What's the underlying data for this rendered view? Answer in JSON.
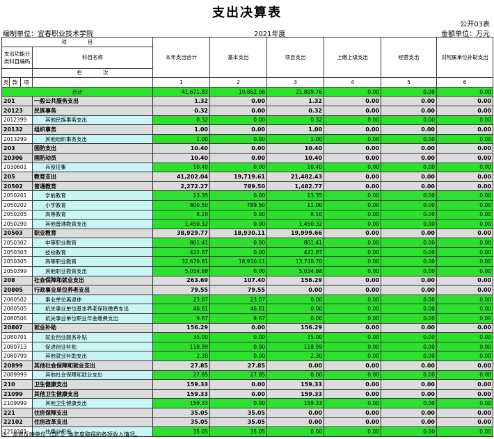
{
  "title": "支出决算表",
  "table_code": "公开03表",
  "unit_label": "编制单位：宜春职业技术学院",
  "year": "2021年度",
  "amount_unit": "金额单位：万元",
  "headers": {
    "xiangmu": "项　　　　目",
    "func_code": "支出功能分类科目编码",
    "subject_name": "科目名称",
    "lan_ci": "栏　　　　次",
    "lei": "类",
    "kuan": "款",
    "xiang": "项",
    "cols": [
      "本年支出合计",
      "基本支出",
      "项目支出",
      "上缴上级支出",
      "经营支出",
      "对附属单位补助支出"
    ],
    "col_nums": [
      "1",
      "2",
      "3",
      "4",
      "5",
      "6"
    ]
  },
  "total_label": "合计",
  "total_values": [
    "41,671.83",
    "19,862.06",
    "21,809.76",
    "0.00",
    "0.00",
    "0.00"
  ],
  "rows": [
    {
      "code": "201",
      "name": "一般公共服务支出",
      "v": [
        "1.32",
        "0.00",
        "1.32",
        "0.00",
        "0.00",
        "0.00"
      ],
      "bold": true
    },
    {
      "code": "20123",
      "name": "民族事务",
      "v": [
        "0.32",
        "0.00",
        "0.32",
        "0.00",
        "0.00",
        "0.00"
      ],
      "bold": true
    },
    {
      "code": "2012399",
      "name": "其他民族事务支出",
      "v": [
        "0.32",
        "0.00",
        "0.32",
        "0.00",
        "0.00",
        "0.00"
      ],
      "bold": false
    },
    {
      "code": "20132",
      "name": "组织事务",
      "v": [
        "1.00",
        "0.00",
        "1.00",
        "0.00",
        "0.00",
        "0.00"
      ],
      "bold": true
    },
    {
      "code": "2013299",
      "name": "其他组织事务支出",
      "v": [
        "1.00",
        "0.00",
        "1.00",
        "0.00",
        "0.00",
        "0.00"
      ],
      "bold": false
    },
    {
      "code": "203",
      "name": "国防支出",
      "v": [
        "10.40",
        "0.00",
        "10.40",
        "0.00",
        "0.00",
        "0.00"
      ],
      "bold": true
    },
    {
      "code": "20306",
      "name": "国防动员",
      "v": [
        "10.40",
        "0.00",
        "10.40",
        "0.00",
        "0.00",
        "0.00"
      ],
      "bold": true
    },
    {
      "code": "2030601",
      "name": "兵役征集",
      "v": [
        "10.40",
        "0.00",
        "10.40",
        "0.00",
        "0.00",
        "0.00"
      ],
      "bold": false
    },
    {
      "code": "205",
      "name": "教育支出",
      "v": [
        "41,202.04",
        "19,719.61",
        "21,482.43",
        "0.00",
        "0.00",
        "0.00"
      ],
      "bold": true
    },
    {
      "code": "20502",
      "name": "普通教育",
      "v": [
        "2,272.27",
        "789.50",
        "1,482.77",
        "0.00",
        "0.00",
        "0.00"
      ],
      "bold": true
    },
    {
      "code": "2050201",
      "name": "学前教育",
      "v": [
        "13.35",
        "0.00",
        "13.35",
        "0.00",
        "0.00",
        "0.00"
      ],
      "bold": false
    },
    {
      "code": "2050202",
      "name": "小学教育",
      "v": [
        "800.50",
        "789.50",
        "11.00",
        "0.00",
        "0.00",
        "0.00"
      ],
      "bold": false
    },
    {
      "code": "2050205",
      "name": "高等教育",
      "v": [
        "8.10",
        "0.00",
        "8.10",
        "0.00",
        "0.00",
        "0.00"
      ],
      "bold": false
    },
    {
      "code": "2050299",
      "name": "其他普通教育支出",
      "v": [
        "1,450.32",
        "0.00",
        "1,450.32",
        "0.00",
        "0.00",
        "0.00"
      ],
      "bold": false
    },
    {
      "code": "20503",
      "name": "职业教育",
      "v": [
        "38,929.77",
        "18,930.11",
        "19,999.66",
        "0.00",
        "0.00",
        "0.00"
      ],
      "bold": true
    },
    {
      "code": "2050302",
      "name": "中等职业教育",
      "v": [
        "801.41",
        "0.00",
        "801.41",
        "0.00",
        "0.00",
        "0.00"
      ],
      "bold": false
    },
    {
      "code": "2050303",
      "name": "技校教育",
      "v": [
        "422.87",
        "0.00",
        "422.87",
        "0.00",
        "0.00",
        "0.00"
      ],
      "bold": false
    },
    {
      "code": "2050305",
      "name": "高等职业教育",
      "v": [
        "32,670.81",
        "18,930.11",
        "13,740.70",
        "0.00",
        "0.00",
        "0.00"
      ],
      "bold": false
    },
    {
      "code": "2050399",
      "name": "其他职业教育支出",
      "v": [
        "5,034.68",
        "0.00",
        "5,034.68",
        "0.00",
        "0.00",
        "0.00"
      ],
      "bold": false
    },
    {
      "code": "208",
      "name": "社会保障和就业支出",
      "v": [
        "263.69",
        "107.40",
        "156.29",
        "0.00",
        "0.00",
        "0.00"
      ],
      "bold": true
    },
    {
      "code": "20805",
      "name": "行政事业单位养老支出",
      "v": [
        "79.55",
        "79.55",
        "0.00",
        "0.00",
        "0.00",
        "0.00"
      ],
      "bold": true
    },
    {
      "code": "2080502",
      "name": "事业单位离退休",
      "v": [
        "23.07",
        "23.07",
        "0.00",
        "0.00",
        "0.00",
        "0.00"
      ],
      "bold": false
    },
    {
      "code": "2080505",
      "name": "机关事业单位基本养老保险缴费支出",
      "v": [
        "46.81",
        "46.81",
        "0.00",
        "0.00",
        "0.00",
        "0.00"
      ],
      "bold": false
    },
    {
      "code": "2080506",
      "name": "机关事业单位职业年金缴费支出",
      "v": [
        "9.67",
        "9.67",
        "0.00",
        "0.00",
        "0.00",
        "0.00"
      ],
      "bold": false
    },
    {
      "code": "20807",
      "name": "就业补助",
      "v": [
        "156.29",
        "0.00",
        "156.29",
        "0.00",
        "0.00",
        "0.00"
      ],
      "bold": true
    },
    {
      "code": "2080701",
      "name": "就业创业服务补贴",
      "v": [
        "35.00",
        "0.00",
        "35.00",
        "0.00",
        "0.00",
        "0.00"
      ],
      "bold": false
    },
    {
      "code": "2080713",
      "name": "促进创业补贴",
      "v": [
        "118.99",
        "0.00",
        "118.99",
        "0.00",
        "0.00",
        "0.00"
      ],
      "bold": false
    },
    {
      "code": "2080799",
      "name": "其他就业补助支出",
      "v": [
        "2.30",
        "0.00",
        "2.30",
        "0.00",
        "0.00",
        "0.00"
      ],
      "bold": false
    },
    {
      "code": "20899",
      "name": "其他社会保障和就业支出",
      "v": [
        "27.85",
        "27.85",
        "0.00",
        "0.00",
        "0.00",
        "0.00"
      ],
      "bold": true
    },
    {
      "code": "2089999",
      "name": "其他社会保障和就业支出",
      "v": [
        "27.85",
        "27.85",
        "0.00",
        "0.00",
        "0.00",
        "0.00"
      ],
      "bold": false
    },
    {
      "code": "210",
      "name": "卫生健康支出",
      "v": [
        "159.33",
        "0.00",
        "159.33",
        "0.00",
        "0.00",
        "0.00"
      ],
      "bold": true
    },
    {
      "code": "21099",
      "name": "其他卫生健康支出",
      "v": [
        "159.33",
        "0.00",
        "159.33",
        "0.00",
        "0.00",
        "0.00"
      ],
      "bold": true
    },
    {
      "code": "2109999",
      "name": "其他卫生健康支出",
      "v": [
        "159.33",
        "0.00",
        "159.33",
        "0.00",
        "0.00",
        "0.00"
      ],
      "bold": false
    },
    {
      "code": "221",
      "name": "住房保障支出",
      "v": [
        "35.05",
        "35.05",
        "0.00",
        "0.00",
        "0.00",
        "0.00"
      ],
      "bold": true
    },
    {
      "code": "22102",
      "name": "住房改革支出",
      "v": [
        "35.05",
        "35.05",
        "0.00",
        "0.00",
        "0.00",
        "0.00"
      ],
      "bold": true
    },
    {
      "code": "2210201",
      "name": "住房公积金",
      "v": [
        "35.05",
        "35.05",
        "0.00",
        "0.00",
        "0.00",
        "0.00"
      ],
      "bold": false
    }
  ],
  "note": "注：本表反映单位（部门）本年度取得的各项收入情况。"
}
